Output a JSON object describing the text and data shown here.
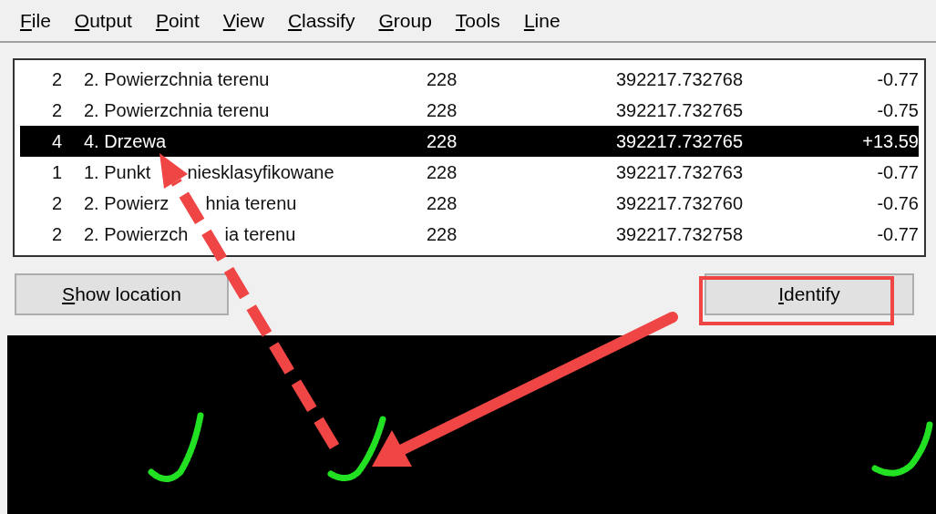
{
  "menu": [
    "File",
    "Output",
    "Point",
    "View",
    "Classify",
    "Group",
    "Tools",
    "Line"
  ],
  "table": {
    "rows": [
      {
        "cells": [
          "2",
          "2. Powierzchnia terenu",
          "228",
          "392217.732768",
          "-0.77"
        ],
        "selected": false
      },
      {
        "cells": [
          "2",
          "2. Powierzchnia terenu",
          "228",
          "392217.732765",
          "-0.75"
        ],
        "selected": false
      },
      {
        "cells": [
          "4",
          "4. Drzewa",
          "228",
          "392217.732765",
          "+13.59"
        ],
        "selected": true
      },
      {
        "cells": [
          "1",
          [
            "1. Punkt",
            "niesklasyfikowane"
          ],
          "228",
          "392217.732763",
          "-0.77"
        ],
        "selected": false
      },
      {
        "cells": [
          "2",
          [
            "2. Powierz",
            "hnia terenu"
          ],
          "228",
          "392217.732760",
          "-0.76"
        ],
        "selected": false
      },
      {
        "cells": [
          "2",
          [
            "2. Powierzch",
            "ia terenu"
          ],
          "228",
          "392217.732758",
          "-0.77"
        ],
        "selected": false
      }
    ]
  },
  "buttons": [
    "Show location",
    "Identify"
  ],
  "annotations": [
    {
      "kind": "highlight-box"
    },
    {
      "kind": "dashed-arrow"
    },
    {
      "kind": "arrow"
    }
  ]
}
